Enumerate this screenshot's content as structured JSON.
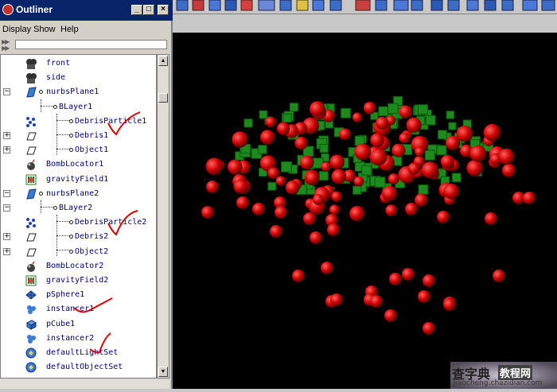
{
  "window": {
    "title": "Outliner",
    "menu": [
      "Display",
      "Show",
      "Help"
    ]
  },
  "outliner_items": [
    {
      "label": "front",
      "icon": "camera-icon",
      "depth": 1
    },
    {
      "label": "side",
      "icon": "camera-icon",
      "depth": 1
    },
    {
      "label": "nurbsPlane1",
      "icon": "nurbs-plane-icon",
      "depth": 1,
      "expander": "minus"
    },
    {
      "label": "BLayer1",
      "icon": "",
      "depth": 2
    },
    {
      "label": "DebrisParticle1",
      "icon": "particle-icon",
      "depth": 3
    },
    {
      "label": "Debris1",
      "icon": "transform-icon",
      "depth": 3,
      "expander": "plus"
    },
    {
      "label": "Object1",
      "icon": "transform-icon",
      "depth": 3,
      "expander": "plus"
    },
    {
      "label": "BombLocator1",
      "icon": "bomb-icon",
      "depth": 1
    },
    {
      "label": "gravityField1",
      "icon": "gravity-field-icon",
      "depth": 1
    },
    {
      "label": "nurbsPlane2",
      "icon": "nurbs-plane-icon",
      "depth": 1,
      "expander": "minus"
    },
    {
      "label": "BLayer2",
      "icon": "",
      "depth": 2,
      "expander": "minus"
    },
    {
      "label": "DebrisParticle2",
      "icon": "particle-icon",
      "depth": 3
    },
    {
      "label": "Debris2",
      "icon": "transform-icon",
      "depth": 3,
      "expander": "plus"
    },
    {
      "label": "Object2",
      "icon": "transform-icon",
      "depth": 3,
      "expander": "plus"
    },
    {
      "label": "BombLocator2",
      "icon": "bomb-icon",
      "depth": 1
    },
    {
      "label": "gravityField2",
      "icon": "gravity-field-icon",
      "depth": 1
    },
    {
      "label": "pSphere1",
      "icon": "poly-sphere-icon",
      "depth": 1
    },
    {
      "label": "instancer1",
      "icon": "instancer-icon",
      "depth": 1
    },
    {
      "label": "pCube1",
      "icon": "poly-cube-icon",
      "depth": 1
    },
    {
      "label": "instancer2",
      "icon": "instancer-icon",
      "depth": 1
    },
    {
      "label": "defaultLightSet",
      "icon": "set-icon",
      "depth": 1
    },
    {
      "label": "defaultObjectSet",
      "icon": "set-icon",
      "depth": 1
    }
  ],
  "watermark": {
    "brand": "查字典",
    "section": "教程网",
    "url": "jiaocheng.chazidian.com"
  },
  "colors": {
    "title_bar": "#0a246a",
    "item_text": "#000080",
    "particle_red": "#cc0000",
    "particle_green": "#1c8a1c",
    "annotation": "#dd0000"
  }
}
